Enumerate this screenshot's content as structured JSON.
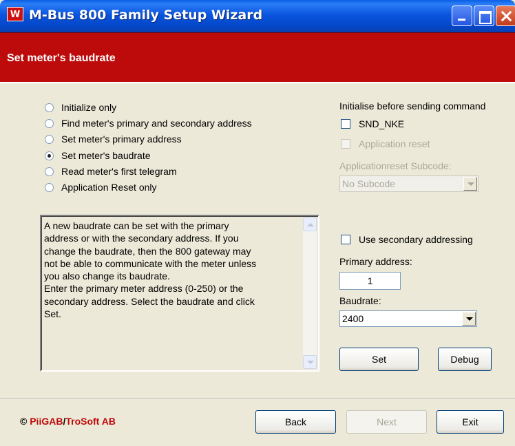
{
  "window": {
    "icon_letter": "W",
    "title": "M-Bus 800 Family Setup Wizard"
  },
  "header": {
    "title": "Set meter's baudrate",
    "color": "#bd0b0b"
  },
  "options": [
    {
      "label": "Initialize only",
      "selected": false
    },
    {
      "label": "Find meter's primary and secondary address",
      "selected": false
    },
    {
      "label": "Set meter's primary address",
      "selected": false
    },
    {
      "label": "Set meter's baudrate",
      "selected": true
    },
    {
      "label": "Read meter's first telegram",
      "selected": false
    },
    {
      "label": "Application Reset only",
      "selected": false
    }
  ],
  "description": "A new baudrate can be set with the primary\naddress or with the secondary address. If you\nchange the baudrate, then the 800 gateway may\nnot be able to communicate with the meter unless\nyou also change its baudrate.\nEnter the primary meter address (0-250) or the\nsecondary address. Select the baudrate and click\nSet.",
  "init": {
    "heading": "Initialise before sending command",
    "snd_nke_label": "SND_NKE",
    "snd_nke_checked": false,
    "app_reset_label": "Application reset",
    "app_reset_checked": false,
    "subcode_label": "Applicationreset Subcode:",
    "subcode_value": "No Subcode"
  },
  "addressing": {
    "secondary_label": "Use secondary addressing",
    "secondary_checked": false,
    "primary_label": "Primary address:",
    "primary_value": "1",
    "baudrate_label": "Baudrate:",
    "baudrate_value": "2400"
  },
  "buttons": {
    "set": "Set",
    "debug": "Debug",
    "back": "Back",
    "next": "Next",
    "exit": "Exit"
  },
  "footer": {
    "copyright_symbol": "©",
    "brand1": "PiiGAB",
    "slash": "/",
    "brand2": "TroSoft AB"
  }
}
